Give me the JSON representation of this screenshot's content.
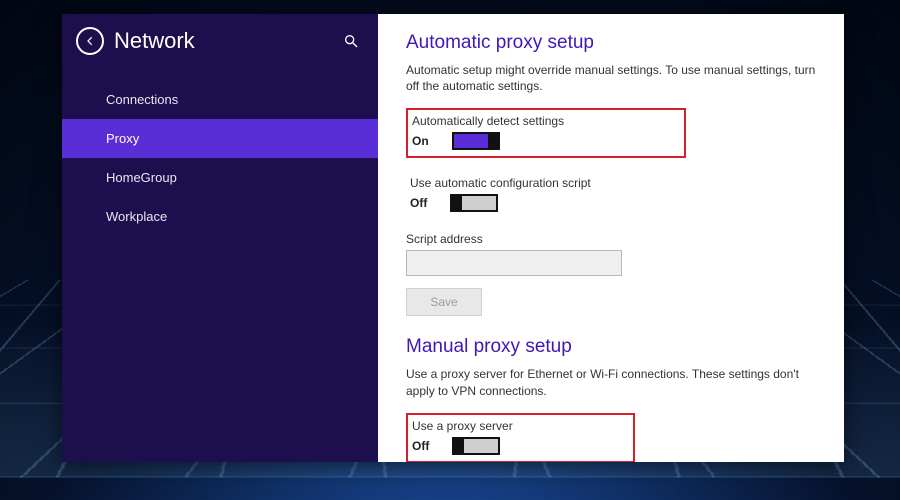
{
  "sidebar": {
    "title": "Network",
    "items": [
      {
        "label": "Connections"
      },
      {
        "label": "Proxy"
      },
      {
        "label": "HomeGroup"
      },
      {
        "label": "Workplace"
      }
    ],
    "selected_index": 1
  },
  "content": {
    "auto": {
      "heading": "Automatic proxy setup",
      "description": "Automatic setup might override manual settings. To use manual settings, turn off the automatic settings.",
      "detect": {
        "label": "Automatically detect settings",
        "state": "On"
      },
      "script_toggle": {
        "label": "Use automatic configuration script",
        "state": "Off"
      },
      "script_address": {
        "label": "Script address",
        "value": ""
      },
      "save_label": "Save"
    },
    "manual": {
      "heading": "Manual proxy setup",
      "description": "Use a proxy server for Ethernet or Wi-Fi connections. These settings don't apply to VPN connections.",
      "use_proxy": {
        "label": "Use a proxy server",
        "state": "Off"
      }
    }
  }
}
